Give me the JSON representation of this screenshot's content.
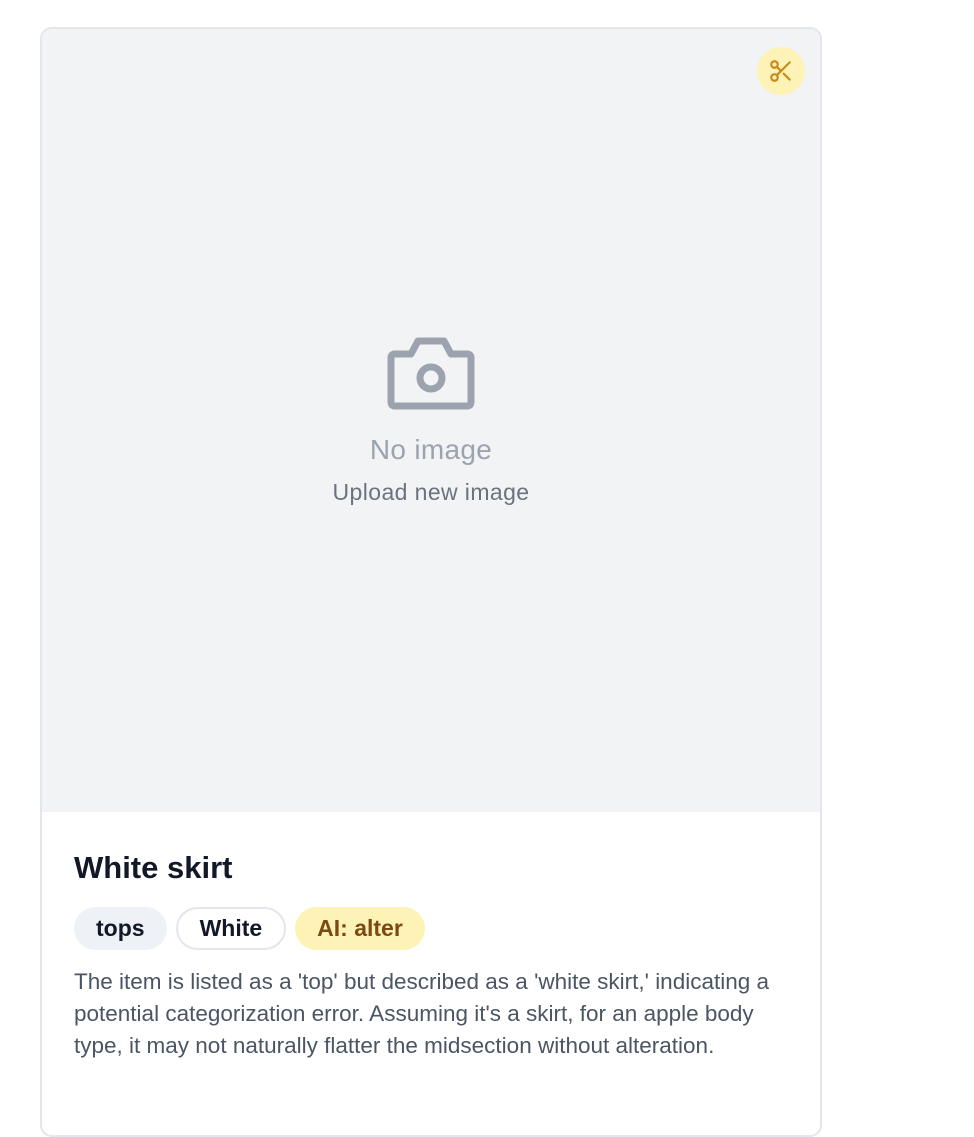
{
  "card": {
    "alter_icon": "scissors-icon",
    "placeholder": {
      "icon": "camera-icon",
      "text": "No image",
      "upload_label": "Upload new image"
    },
    "title": "White skirt",
    "tags": [
      {
        "label": "tops"
      },
      {
        "label": "White"
      },
      {
        "label": "AI: alter"
      }
    ],
    "description": "The item is listed as a 'top' but described as a 'white skirt,' indicating a potential categorization error. Assuming it's a skirt, for an apple body type, it may not naturally flatter the midsection without alteration."
  },
  "colors": {
    "accent_yellow": "#fdf3b6",
    "icon_gold": "#c98a1c",
    "ai_tag_text": "#7a4a12",
    "placeholder_bg": "#f2f3f5"
  }
}
